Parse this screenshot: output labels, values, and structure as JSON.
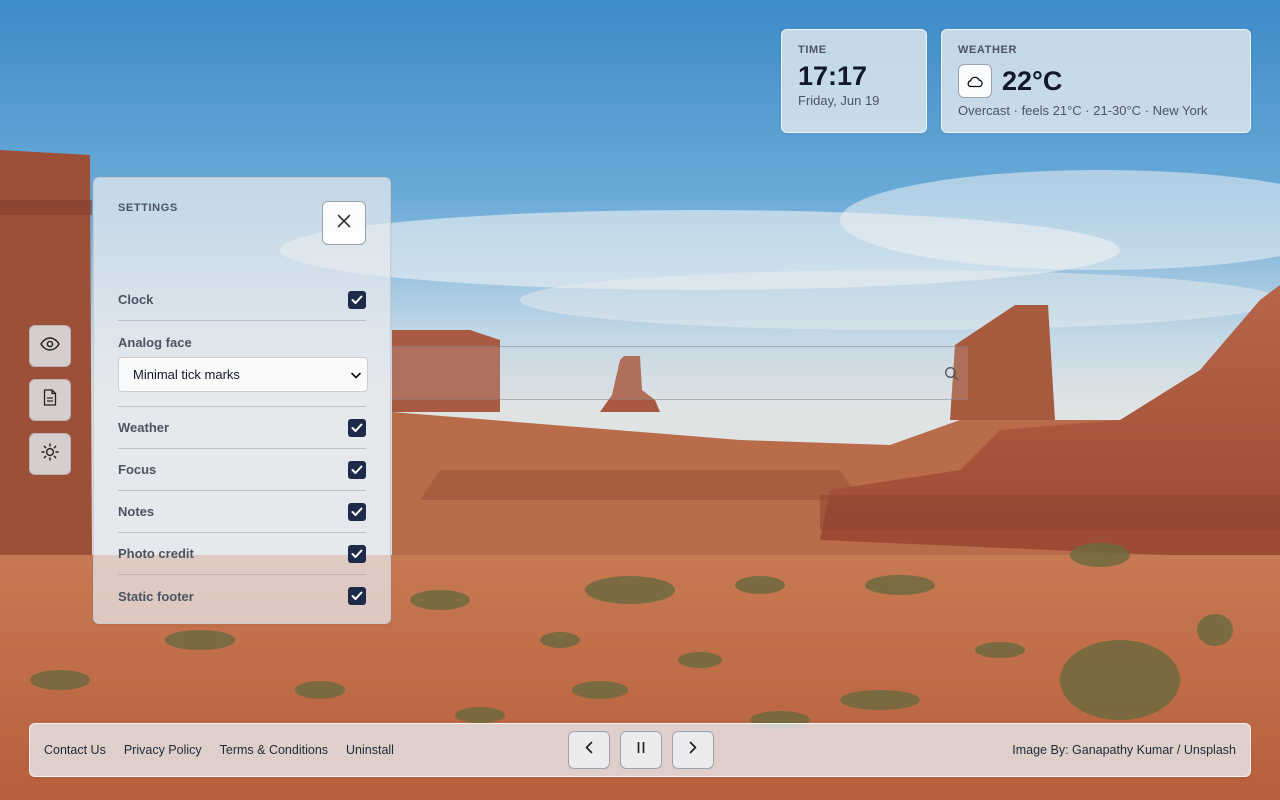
{
  "widgets": {
    "time": {
      "label": "TIME",
      "value": "17:17",
      "date": "Friday, Jun 19"
    },
    "weather": {
      "label": "WEATHER",
      "icon": "cloud-icon",
      "temperature": "22°C",
      "detail": "Overcast · feels 21°C · 21-30°C · New York"
    }
  },
  "dock": {
    "items": [
      {
        "icon": "eye-icon"
      },
      {
        "icon": "document-icon"
      },
      {
        "icon": "sun-icon"
      }
    ]
  },
  "settings": {
    "title": "SETTINGS",
    "close_icon": "close-icon",
    "rows": [
      {
        "label": "Clock",
        "checked": true
      },
      {
        "label": "Weather",
        "checked": true
      },
      {
        "label": "Focus",
        "checked": true
      },
      {
        "label": "Notes",
        "checked": true
      },
      {
        "label": "Photo credit",
        "checked": true
      },
      {
        "label": "Static footer",
        "checked": true
      }
    ],
    "analog_face": {
      "label": "Analog face",
      "selected": "Minimal tick marks"
    }
  },
  "search": {
    "icon": "search-icon"
  },
  "footer": {
    "links": [
      "Contact Us",
      "Privacy Policy",
      "Terms & Conditions",
      "Uninstall"
    ],
    "controls": [
      {
        "icon": "chevron-left-icon"
      },
      {
        "icon": "pause-icon"
      },
      {
        "icon": "chevron-right-icon"
      }
    ],
    "credit": "Image By: Ganapathy Kumar / Unsplash"
  },
  "colors": {
    "checkbox": "#1e2a4a",
    "sky_top": "#3f8fca",
    "sand": "#c8724a"
  }
}
